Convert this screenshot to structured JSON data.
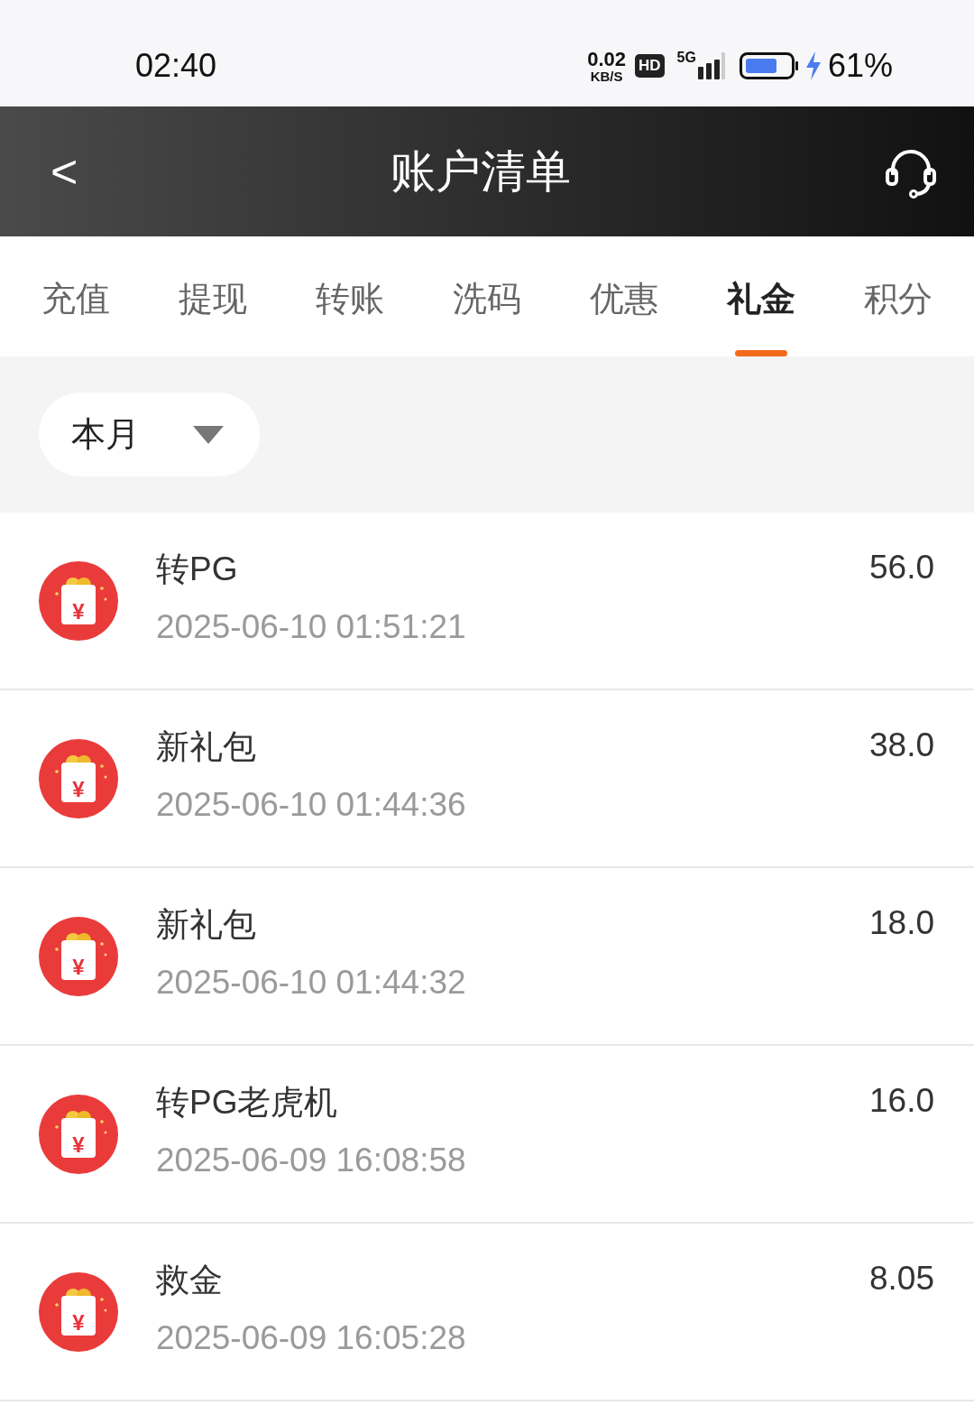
{
  "status_bar": {
    "time": "02:40",
    "speed": "0.02",
    "speed_unit": "KB/S",
    "hd": "HD",
    "network": "5G",
    "battery": "61%",
    "charging": true
  },
  "header": {
    "back": "<",
    "title": "账户清单"
  },
  "tabs": [
    {
      "label": "充值",
      "selected": false
    },
    {
      "label": "提现",
      "selected": false
    },
    {
      "label": "转账",
      "selected": false
    },
    {
      "label": "洗码",
      "selected": false
    },
    {
      "label": "优惠",
      "selected": false
    },
    {
      "label": "礼金",
      "selected": true
    },
    {
      "label": "积分",
      "selected": false
    }
  ],
  "filter": {
    "value": "本月"
  },
  "records": [
    {
      "title": "转PG",
      "time": "2025-06-10 01:51:21",
      "amount": "56.0",
      "icon_glyph": "¥"
    },
    {
      "title": "新礼包",
      "time": "2025-06-10 01:44:36",
      "amount": "38.0",
      "icon_glyph": "¥"
    },
    {
      "title": "新礼包",
      "time": "2025-06-10 01:44:32",
      "amount": "18.0",
      "icon_glyph": "¥"
    },
    {
      "title": "转PG老虎机",
      "time": "2025-06-09 16:08:58",
      "amount": "16.0",
      "icon_glyph": "¥"
    },
    {
      "title": "救金",
      "time": "2025-06-09 16:05:28",
      "amount": "8.05",
      "icon_glyph": "¥"
    }
  ]
}
